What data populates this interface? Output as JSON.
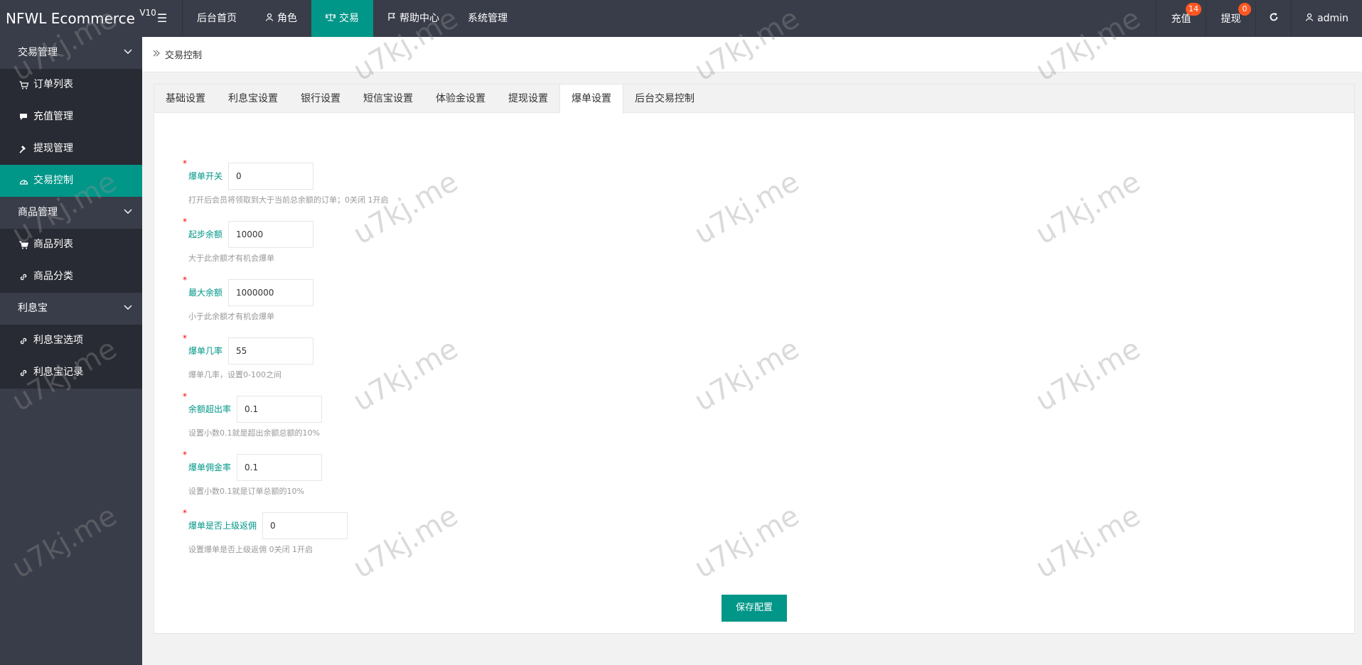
{
  "app": {
    "name": "NFWL Ecommerce",
    "version": "V10"
  },
  "topnav": {
    "items": [
      {
        "label": "后台首页"
      },
      {
        "label": "角色"
      },
      {
        "label": "交易"
      },
      {
        "label": "帮助中心"
      },
      {
        "label": "系统管理"
      }
    ]
  },
  "topright": {
    "recharge_label": "充值",
    "recharge_count": "14",
    "withdraw_label": "提现",
    "withdraw_count": "0",
    "user_label": "admin"
  },
  "sidebar": {
    "groups": [
      {
        "title": "交易管理",
        "items": [
          {
            "label": "订单列表"
          },
          {
            "label": "充值管理"
          },
          {
            "label": "提现管理"
          },
          {
            "label": "交易控制"
          }
        ]
      },
      {
        "title": "商品管理",
        "items": [
          {
            "label": "商品列表"
          },
          {
            "label": "商品分类"
          }
        ]
      },
      {
        "title": "利息宝",
        "items": [
          {
            "label": "利息宝选项"
          },
          {
            "label": "利息宝记录"
          }
        ]
      }
    ]
  },
  "breadcrumb": {
    "current": "交易控制"
  },
  "tabs": [
    "基础设置",
    "利息宝设置",
    "银行设置",
    "短信宝设置",
    "体验金设置",
    "提现设置",
    "爆单设置",
    "后台交易控制"
  ],
  "form": {
    "fields": [
      {
        "label": "爆单开关",
        "value": "0",
        "hint": "打开后会员将领取到大于当前总余额的订单；0关闭 1开启"
      },
      {
        "label": "起步余额",
        "value": "10000",
        "hint": "大于此余额才有机会爆单"
      },
      {
        "label": "最大余额",
        "value": "1000000",
        "hint": "小于此余额才有机会爆单"
      },
      {
        "label": "爆单几率",
        "value": "55",
        "hint": "爆单几率，设置0-100之间"
      },
      {
        "label": "余额超出率",
        "value": "0.1",
        "hint": "设置小数0.1就是超出余额总额的10%"
      },
      {
        "label": "爆单佣金率",
        "value": "0.1",
        "hint": "设置小数0.1就是订单总额的10%"
      },
      {
        "label": "爆单是否上级返佣",
        "value": "0",
        "hint": "设置爆单是否上级返佣 0关闭 1开启"
      }
    ],
    "required_mark": "*",
    "save_label": "保存配置"
  },
  "watermark": "u7kj.me",
  "colors": {
    "accent": "#009688",
    "header": "#393d49",
    "badge": "#ff5722"
  }
}
